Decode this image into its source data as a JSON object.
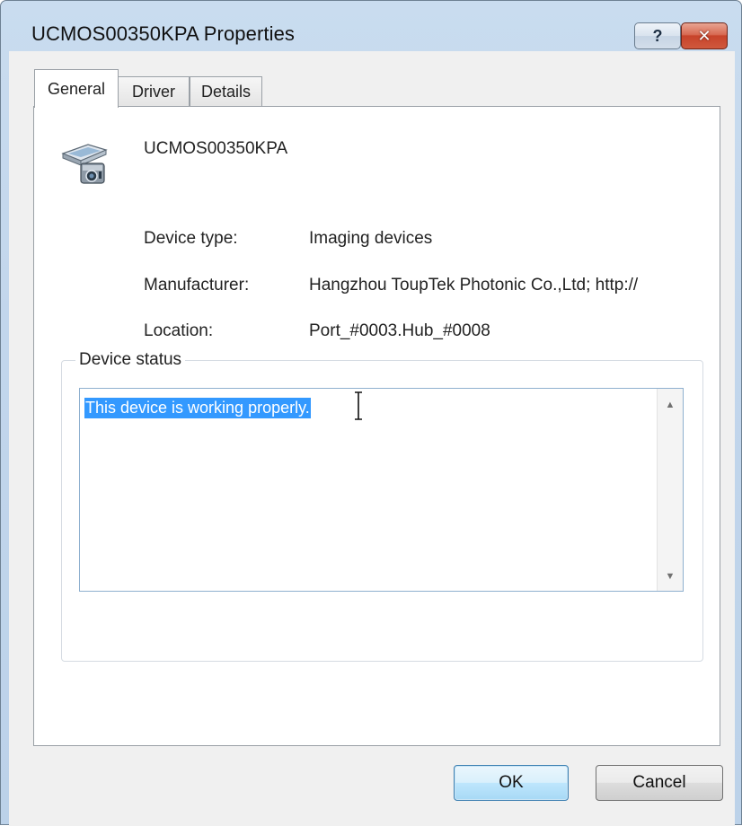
{
  "window": {
    "title": "UCMOS00350KPA Properties",
    "help_label": "?",
    "close_label": "✕"
  },
  "tabs": [
    {
      "label": "General",
      "active": true
    },
    {
      "label": "Driver",
      "active": false
    },
    {
      "label": "Details",
      "active": false
    }
  ],
  "device": {
    "name": "UCMOS00350KPA",
    "icon": "camera-device-icon"
  },
  "properties": {
    "type_label": "Device type:",
    "type_value": "Imaging devices",
    "manufacturer_label": "Manufacturer:",
    "manufacturer_value": "Hangzhou ToupTek Photonic  Co.,Ltd; http://",
    "location_label": "Location:",
    "location_value": "Port_#0003.Hub_#0008"
  },
  "status": {
    "group_title": "Device status",
    "text": "This device is working properly."
  },
  "buttons": {
    "ok": "OK",
    "cancel": "Cancel"
  },
  "colors": {
    "selection": "#3399ff",
    "ok_border": "#3c7fb1",
    "close_red": "#c7432a"
  }
}
